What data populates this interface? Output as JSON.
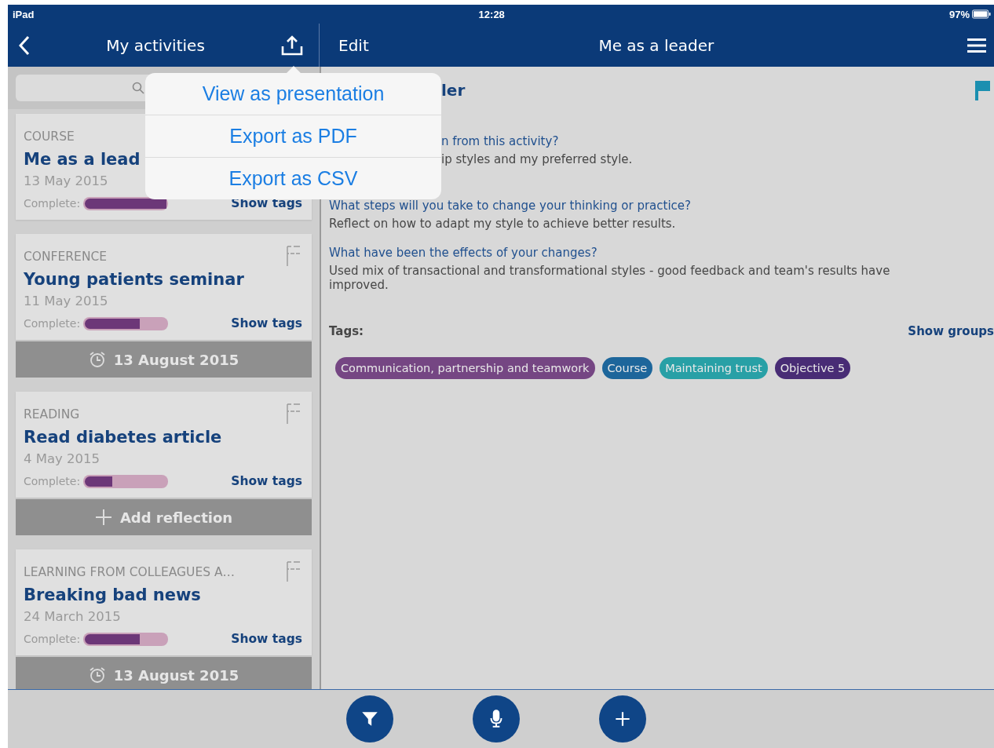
{
  "status_bar": {
    "device": "iPad",
    "time": "12:28",
    "battery": "97%"
  },
  "left_nav": {
    "title": "My activities"
  },
  "right_nav": {
    "edit": "Edit",
    "title": "Me as a leader"
  },
  "activities": [
    {
      "category": "COURSE",
      "title": "Me as a lead",
      "date": "13 May 2015",
      "complete_label": "Complete:",
      "level": 1.0,
      "flag": false,
      "show_tags": "Show tags"
    },
    {
      "category": "CONFERENCE",
      "title": "Young patients seminar",
      "date": "11 May 2015",
      "complete_label": "Complete:",
      "level": 0.67,
      "flag": true,
      "show_tags": "Show tags",
      "footer": {
        "kind": "reminder",
        "text": "13 August 2015"
      }
    },
    {
      "category": "READING",
      "title": "Read diabetes article",
      "date": "4 May 2015",
      "complete_label": "Complete:",
      "level": 0.33,
      "flag": true,
      "show_tags": "Show tags",
      "footer": {
        "kind": "add",
        "text": "Add reflection"
      }
    },
    {
      "category": "LEARNING FROM COLLEAGUES A…",
      "title": "Breaking bad news",
      "date": "24 March 2015",
      "complete_label": "Complete:",
      "level": 0.67,
      "flag": true,
      "show_tags": "Show tags",
      "footer": {
        "kind": "reminder",
        "text": "13 August 2015"
      }
    }
  ],
  "detail": {
    "title": "ler",
    "flagged": true,
    "questions": [
      {
        "question": "n from this activity?",
        "answer": "ip styles and my preferred style.",
        "covered": true
      },
      {
        "question": "What steps will you take to change your thinking or practice?",
        "answer": "Reflect on how to adapt my style to achieve better results.",
        "covered": false
      },
      {
        "question": "What have been the effects of your changes?",
        "answer": "Used mix of transactional and transformational styles - good feedback and team's results have improved.",
        "covered": false
      }
    ],
    "tags_label": "Tags:",
    "show_groups": "Show groups",
    "tags": [
      {
        "label": "Communication, partnership and teamwork",
        "color": "#754683"
      },
      {
        "label": "Course",
        "color": "#1d669b"
      },
      {
        "label": "Maintaining trust",
        "color": "#28a0a6"
      },
      {
        "label": "Objective 5",
        "color": "#482c75"
      }
    ]
  },
  "popover": {
    "items": [
      "View as presentation",
      "Export as PDF",
      "Export as CSV"
    ]
  },
  "toolbar": [
    {
      "kind": "filter"
    },
    {
      "kind": "mic"
    },
    {
      "kind": "add"
    }
  ]
}
